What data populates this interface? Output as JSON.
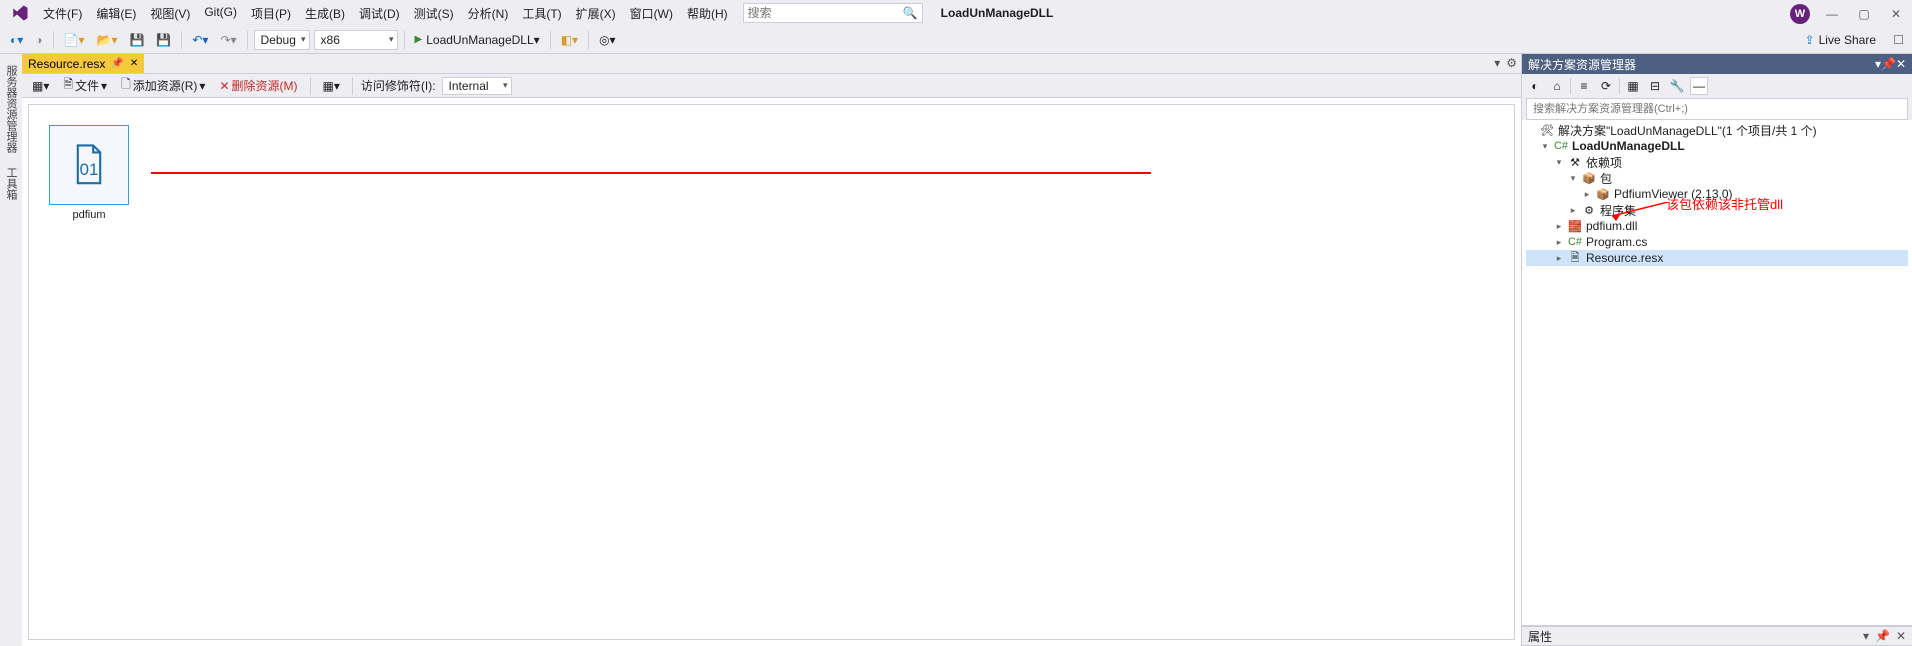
{
  "menu": [
    "文件(F)",
    "编辑(E)",
    "视图(V)",
    "Git(G)",
    "项目(P)",
    "生成(B)",
    "调试(D)",
    "测试(S)",
    "分析(N)",
    "工具(T)",
    "扩展(X)",
    "窗口(W)",
    "帮助(H)"
  ],
  "search_placeholder": "搜索",
  "project_name": "LoadUnManageDLL",
  "live_share": "Live Share",
  "toolbar": {
    "config": "Debug",
    "platform": "x86",
    "run_target": "LoadUnManageDLL"
  },
  "left_rail": [
    "服务器资源管理器",
    "工具箱"
  ],
  "doc_tab": "Resource.resx",
  "doc_toolbar": {
    "file": "文件",
    "add": "添加资源(R)",
    "del": "删除资源(M)",
    "access": "访问修饰符(I):",
    "access_val": "Internal"
  },
  "resource_item": "pdfium",
  "right": {
    "title": "解决方案资源管理器",
    "search_placeholder": "搜索解决方案资源管理器(Ctrl+;)",
    "solution": "解决方案\"LoadUnManageDLL\"(1 个项目/共 1 个)",
    "project": "LoadUnManageDLL",
    "deps": "依赖项",
    "pkgs": "包",
    "pkg1": "PdfiumViewer (2.13.0)",
    "asm": "程序集",
    "dll": "pdfium.dll",
    "cs": "Program.cs",
    "resx": "Resource.resx",
    "props": "属性"
  },
  "annotation": "该包依赖该非托管dll"
}
